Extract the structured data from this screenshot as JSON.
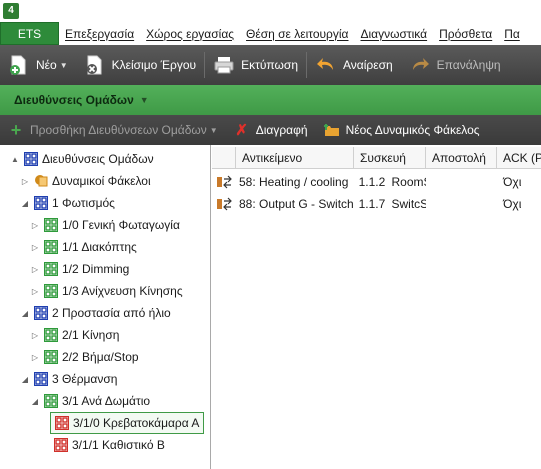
{
  "menu": {
    "ets": "ETS",
    "items": [
      "Επεξεργασία",
      "Χώρος εργασίας",
      "Θέση σε λειτουργία",
      "Διαγνωστικά",
      "Πρόσθετα",
      "Πα"
    ]
  },
  "toolbar": {
    "new": "Νέο",
    "close_project": "Κλείσιμο Έργου",
    "print": "Εκτύπωση",
    "undo": "Αναίρεση",
    "redo": "Επανάληψη"
  },
  "panel": {
    "title": "Διευθύνσεις Ομάδων"
  },
  "subtoolbar": {
    "add_group_addresses": "Προσθήκη Διευθύνσεων Ομάδων",
    "delete": "Διαγραφή",
    "new_dynamic_folder": "Νέος Δυναμικός Φάκελος"
  },
  "tree": [
    {
      "label": "Διευθύνσεις Ομάδων",
      "level": 0,
      "expander": "▲",
      "icon": "root-grid-icon",
      "color": "#1f3fb0"
    },
    {
      "label": "Δυναμικοί Φάκελοι",
      "level": 1,
      "expander": "▷",
      "icon": "dynamic-folder-icon",
      "color": "#d08a1a"
    },
    {
      "label": "1 Φωτισμός",
      "level": 1,
      "expander": "◢",
      "icon": "main-group-icon",
      "color": "#1f3fb0"
    },
    {
      "label": "1/0 Γενική Φωταγωγία",
      "level": 2,
      "expander": "▷",
      "icon": "middle-group-icon",
      "color": "#2e9a3a"
    },
    {
      "label": "1/1 Διακόπτης",
      "level": 2,
      "expander": "▷",
      "icon": "middle-group-icon",
      "color": "#2e9a3a"
    },
    {
      "label": "1/2 Dimming",
      "level": 2,
      "expander": "▷",
      "icon": "middle-group-icon",
      "color": "#2e9a3a"
    },
    {
      "label": "1/3 Ανίχνευση Κίνησης",
      "level": 2,
      "expander": "▷",
      "icon": "middle-group-icon",
      "color": "#2e9a3a"
    },
    {
      "label": "2 Προστασία από ήλιο",
      "level": 1,
      "expander": "◢",
      "icon": "main-group-icon",
      "color": "#1f3fb0"
    },
    {
      "label": "2/1 Κίνηση",
      "level": 2,
      "expander": "▷",
      "icon": "middle-group-icon",
      "color": "#2e9a3a"
    },
    {
      "label": "2/2 Βήμα/Stop",
      "level": 2,
      "expander": "▷",
      "icon": "middle-group-icon",
      "color": "#2e9a3a"
    },
    {
      "label": "3 Θέρμανση",
      "level": 1,
      "expander": "◢",
      "icon": "main-group-icon",
      "color": "#1f3fb0"
    },
    {
      "label": "3/1 Ανά Δωμάτιο",
      "level": 2,
      "expander": "◢",
      "icon": "middle-group-icon",
      "color": "#2e9a3a"
    },
    {
      "label": "3/1/0 Κρεβατοκάμαρα Α",
      "level": 3,
      "expander": "",
      "icon": "group-address-icon",
      "color": "#d0302a",
      "selected": true
    },
    {
      "label": "3/1/1 Καθιστικό Β",
      "level": 3,
      "expander": "",
      "icon": "group-address-icon",
      "color": "#d0302a"
    }
  ],
  "list": {
    "columns": [
      "Αντικείμενο",
      "Συσκευή",
      "Αποστολή",
      "ACK (P..."
    ],
    "rows": [
      {
        "object": "58: Heating / cooling",
        "device": "1.1.2",
        "device_name": "RoomS",
        "send": "",
        "ack": "Όχι"
      },
      {
        "object": "88: Output G - Switch",
        "device": "1.1.7",
        "device_name": "SwitcS",
        "send": "",
        "ack": "Όχι"
      }
    ]
  }
}
